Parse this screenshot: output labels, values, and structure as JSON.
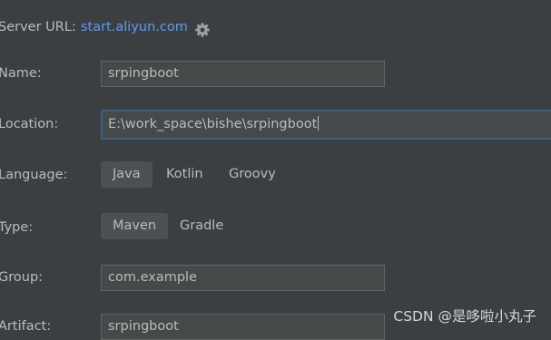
{
  "server": {
    "label": "Server URL:",
    "url": "start.aliyun.com",
    "settings_icon": "gear-icon"
  },
  "form": {
    "name": {
      "label": "Name:",
      "value": "srpingboot"
    },
    "location": {
      "label": "Location:",
      "value": "E:\\work_space\\bishe\\srpingboot"
    },
    "language": {
      "label": "Language:",
      "options": [
        "Java",
        "Kotlin",
        "Groovy"
      ],
      "selected": "Java"
    },
    "type": {
      "label": "Type:",
      "options": [
        "Maven",
        "Gradle"
      ],
      "selected": "Maven"
    },
    "group": {
      "label": "Group:",
      "value": "com.example"
    },
    "artifact": {
      "label": "Artifact:",
      "value": "srpingboot"
    }
  },
  "watermark": "CSDN @是哆啦小丸子",
  "colors": {
    "background": "#3c3f41",
    "link": "#589df6",
    "field_bg": "#45494a",
    "focus_border": "#3d6185",
    "selected_option": "#4c5052"
  }
}
